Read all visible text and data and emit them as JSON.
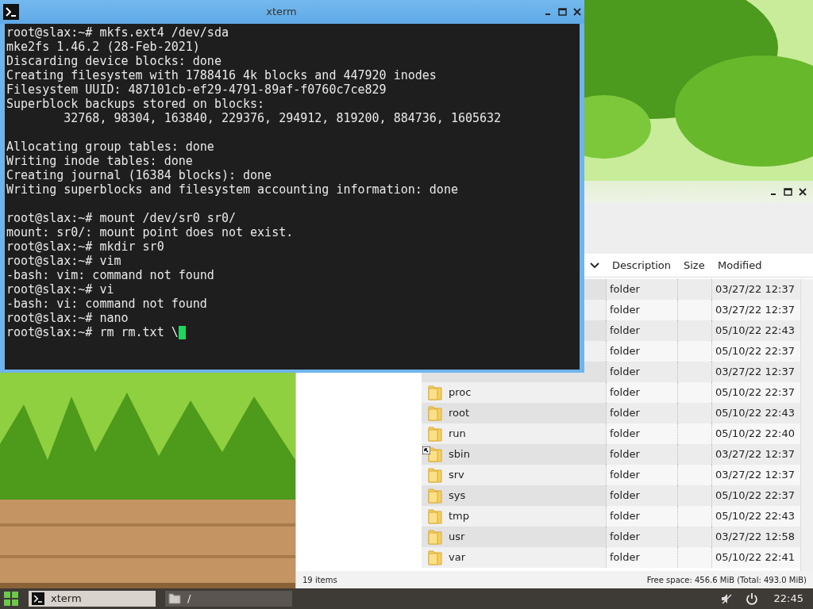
{
  "xterm": {
    "title": "xterm",
    "cursor": true,
    "lines": [
      "root@slax:~# mkfs.ext4 /dev/sda",
      "mke2fs 1.46.2 (28-Feb-2021)",
      "Discarding device blocks: done",
      "Creating filesystem with 1788416 4k blocks and 447920 inodes",
      "Filesystem UUID: 487101cb-ef29-4791-89af-f0760c7ce829",
      "Superblock backups stored on blocks:",
      "        32768, 98304, 163840, 229376, 294912, 819200, 884736, 1605632",
      {
        "text": "Allocating group tables: done",
        "blank_before": true
      },
      "Writing inode tables: done",
      "Creating journal (16384 blocks): done",
      "Writing superblocks and filesystem accounting information: done",
      {
        "text": "root@slax:~# mount /dev/sr0 sr0/",
        "blank_before": true
      },
      "mount: sr0/: mount point does not exist.",
      "root@slax:~# mkdir sr0",
      "root@slax:~# vim",
      "-bash: vim: command not found",
      "root@slax:~# vi",
      "-bash: vi: command not found",
      "root@slax:~# nano",
      "root@slax:~# rm rm.txt \\"
    ]
  },
  "file_manager": {
    "columns": [
      "Description",
      "Size",
      "Modified"
    ],
    "rows": [
      {
        "description": "folder",
        "modified": "03/27/22 12:37"
      },
      {
        "description": "folder",
        "modified": "03/27/22 12:37"
      },
      {
        "description": "folder",
        "modified": "05/10/22 22:43"
      },
      {
        "description": "folder",
        "modified": "05/10/22 22:37"
      },
      {
        "description": "folder",
        "modified": "03/27/22 12:37"
      },
      {
        "name": "proc",
        "description": "folder",
        "modified": "05/10/22 22:37",
        "symlink": false
      },
      {
        "name": "root",
        "description": "folder",
        "modified": "05/10/22 22:43",
        "symlink": false
      },
      {
        "name": "run",
        "description": "folder",
        "modified": "05/10/22 22:40",
        "symlink": false
      },
      {
        "name": "sbin",
        "description": "folder",
        "modified": "03/27/22 12:37",
        "symlink": true
      },
      {
        "name": "srv",
        "description": "folder",
        "modified": "03/27/22 12:37",
        "symlink": false
      },
      {
        "name": "sys",
        "description": "folder",
        "modified": "05/10/22 22:37",
        "symlink": false
      },
      {
        "name": "tmp",
        "description": "folder",
        "modified": "05/10/22 22:43",
        "symlink": false
      },
      {
        "name": "usr",
        "description": "folder",
        "modified": "03/27/22 12:58",
        "symlink": false
      },
      {
        "name": "var",
        "description": "folder",
        "modified": "05/10/22 22:41",
        "symlink": false
      }
    ],
    "status_left": "19 items",
    "status_right": "Free space: 456.6 MiB (Total: 493.0 MiB)"
  },
  "taskbar": {
    "tasks": [
      {
        "label": "xterm",
        "kind": "terminal",
        "active": true
      },
      {
        "label": "/",
        "kind": "folder",
        "active": false
      }
    ],
    "clock": "22:45"
  }
}
